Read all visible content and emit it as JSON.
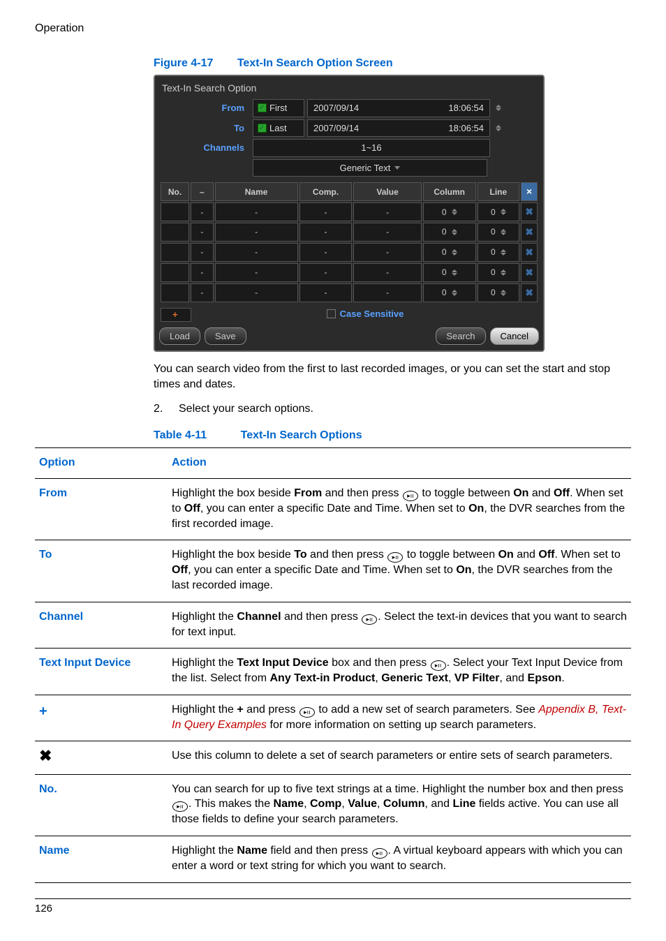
{
  "page": {
    "section": "Operation",
    "footer_page": "126"
  },
  "figure": {
    "id": "Figure 4-17",
    "title": "Text-In Search Option Screen"
  },
  "dialog": {
    "title": "Text-In Search Option",
    "labels": {
      "from": "From",
      "to": "To",
      "channels": "Channels"
    },
    "from": {
      "chk_label": "First",
      "date": "2007/09/14",
      "time": "18:06:54"
    },
    "to": {
      "chk_label": "Last",
      "date": "2007/09/14",
      "time": "18:06:54"
    },
    "channels_value": "1~16",
    "device_selected": "Generic Text",
    "headers": {
      "no": "No.",
      "dash": "–",
      "name": "Name",
      "comp": "Comp.",
      "value": "Value",
      "column": "Column",
      "line": "Line"
    },
    "rows": [
      {
        "column": "0",
        "line": "0"
      },
      {
        "column": "0",
        "line": "0"
      },
      {
        "column": "0",
        "line": "0"
      },
      {
        "column": "0",
        "line": "0"
      },
      {
        "column": "0",
        "line": "0"
      }
    ],
    "case_sensitive": "Case Sensitive",
    "buttons": {
      "load": "Load",
      "save": "Save",
      "search": "Search",
      "cancel": "Cancel"
    }
  },
  "after_figure": "You can search video from the first to last recorded images, or you can set the start and stop times and dates.",
  "step2": {
    "num": "2.",
    "text": "Select your search options."
  },
  "table_caption": {
    "id": "Table 4-11",
    "title": "Text-In Search Options"
  },
  "opts_headers": {
    "option": "Option",
    "action": "Action"
  },
  "opts": {
    "from": {
      "label": "From",
      "t1": "Highlight the box beside ",
      "b1": "From",
      "t2": " and then press ",
      "t3": " to toggle between ",
      "b2": "On",
      "t4": " and ",
      "b3": "Off",
      "t5": ". When set to ",
      "b4": "Off",
      "t6": ", you can enter a specific Date and Time. When set to ",
      "b5": "On",
      "t7": ", the DVR searches from the first recorded image."
    },
    "to": {
      "label": "To",
      "t1": "Highlight the box beside ",
      "b1": "To",
      "t2": " and then press ",
      "t3": " to toggle between ",
      "b2": "On",
      "t4": " and ",
      "b3": "Off",
      "t5": ". When set to ",
      "b4": "Off",
      "t6": ", you can enter a specific Date and Time. When set to ",
      "b5": "On",
      "t7": ", the DVR searches from the last recorded image."
    },
    "channel": {
      "label": "Channel",
      "t1": "Highlight the ",
      "b1": "Channel",
      "t2": " and then press ",
      "t3": ". Select the text-in devices that you want to search for text input."
    },
    "tid": {
      "label": "Text Input Device",
      "t1": "Highlight the ",
      "b1": "Text Input Device",
      "t2": " box and then press ",
      "t3": ". Select your Text Input Device from the list. Select from ",
      "b2": "Any Text-in Product",
      "t4": ", ",
      "b3": "Generic Text",
      "t5": ", ",
      "b4": "VP Filter",
      "t6": ", and ",
      "b5": "Epson",
      "t7": "."
    },
    "plus": {
      "label": "+",
      "t1": "Highlight the ",
      "b1": "+",
      "t2": " and press ",
      "t3": " to add a new set of search parameters. See ",
      "appendix": "Appendix B, Text-In Query Examples",
      "t4": " for more information on setting up search parameters."
    },
    "x": {
      "text": "Use this column to delete a set of search parameters or entire sets of search parameters."
    },
    "no": {
      "label": "No.",
      "t1": "You can search for up to five text strings at a time. Highlight the number box and then press ",
      "t2": ". This makes the ",
      "b1": "Name",
      "t3": ", ",
      "b2": "Comp",
      "t4": ", ",
      "b3": "Value",
      "t5": ", ",
      "b4": "Column",
      "t6": ", and ",
      "b5": "Line",
      "t7": " fields active. You can use all those fields to define your search parameters."
    },
    "name": {
      "label": "Name",
      "t1": "Highlight the ",
      "b1": "Name",
      "t2": " field and then press ",
      "t3": ". A virtual keyboard appears with which you can enter a word or text string for which you want to search."
    }
  },
  "icon_glyph": "▸ıı"
}
